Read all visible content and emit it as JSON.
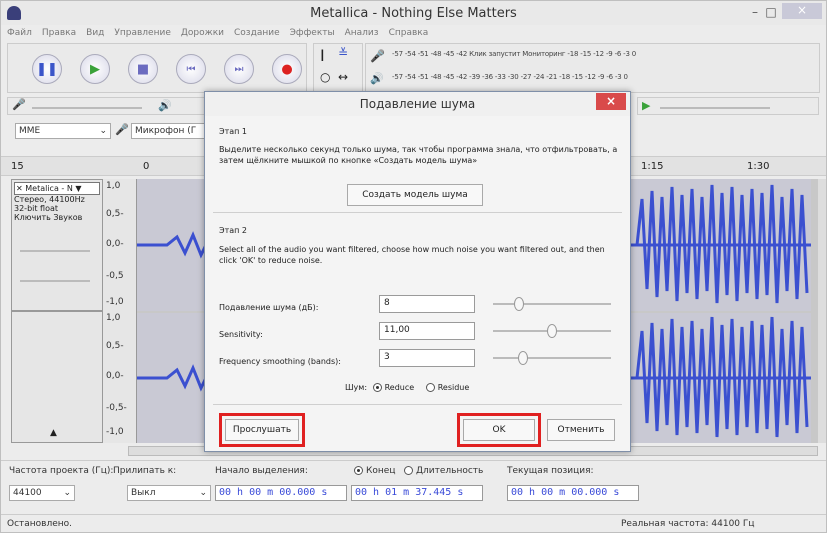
{
  "title": "Metallica - Nothing Else Matters",
  "window_controls": {
    "min": "–",
    "max": "□",
    "close": "×"
  },
  "menu": [
    "Файл",
    "Правка",
    "Вид",
    "Управление",
    "Дорожки",
    "Создание",
    "Эффекты",
    "Анализ",
    "Справка"
  ],
  "meters": {
    "record_scale": "-57 -54 -51 -48 -45 -42 Клик запустит Мониторинг -18 -15 -12 -9 -6 -3 0",
    "play_scale": "-57 -54 -51 -48 -45 -42 -39 -36 -33 -30 -27 -24 -21 -18 -15 -12 -9 -6 -3 0"
  },
  "device": {
    "host": "MME",
    "mic": "Микрофон (Г"
  },
  "ruler": {
    "left": "15",
    "mid1": "0",
    "t1": "1:15",
    "t2": "1:30"
  },
  "track": {
    "name": "Metalica - N ▼",
    "info1": "Стерео, 44100Hz",
    "info2": "32-bit float",
    "info3": "Ключить Звуков",
    "scale_top": [
      "1,0",
      "0,5-",
      "0,0-",
      "-0,5",
      "-1,0"
    ],
    "scale_bottom": [
      "1,0",
      "0,5-",
      "0,0-",
      "-0,5-",
      "-1,0"
    ]
  },
  "dialog": {
    "title": "Подавление шума",
    "close": "×",
    "step1_title": "Этап 1",
    "step1_text": "Выделите несколько секунд только шума, так чтобы программа знала, что отфильтровать, а затем щёлкните мышкой по кнопке «Создать модель шума»",
    "profile_button": "Создать модель шума",
    "step2_title": "Этап 2",
    "step2_text": "Select all of the audio you want filtered, choose how much noise you want filtered out, and then click 'OK' to reduce noise.",
    "noise_label": "Подавление шума (дБ):",
    "noise_value": "8",
    "noise_level": 0.22,
    "sens_label": "Sensitivity:",
    "sens_value": "11,00",
    "sens_level": 0.5,
    "freq_label": "Frequency smoothing (bands):",
    "freq_value": "3",
    "freq_level": 0.25,
    "noise_mode_label": "Шум:",
    "reduce": "Reduce",
    "residue": "Residue",
    "preview": "Прослушать",
    "ok": "OK",
    "cancel": "Отменить"
  },
  "selection": {
    "rate_label": "Частота проекта (Гц):",
    "rate_value": "44100",
    "snap_label": "Прилипать к:",
    "snap_value": "Выкл",
    "start_label": "Начало выделения:",
    "end_label": "Конец",
    "length_label": "Длительность",
    "start_value": "00 h 00 m 00.000 s",
    "end_value": "00 h 01 m 37.445 s",
    "pos_label": "Текущая позиция:",
    "pos_value": "00 h 00 m 00.000 s"
  },
  "status": {
    "left": "Остановлено.",
    "right": "Реальная частота: 44100 Гц"
  }
}
